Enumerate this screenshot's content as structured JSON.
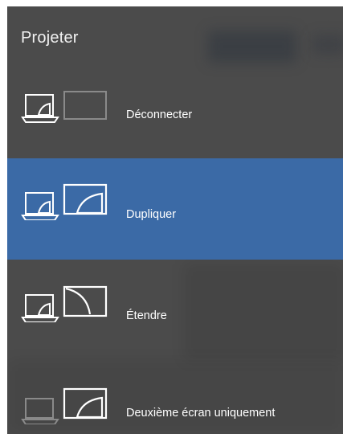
{
  "panel": {
    "title": "Projeter"
  },
  "options": [
    {
      "id": "disconnect",
      "label": "Déconnecter",
      "icon": "pc-screen-only-icon",
      "selected": false
    },
    {
      "id": "duplicate",
      "label": "Dupliquer",
      "icon": "duplicate-icon",
      "selected": true
    },
    {
      "id": "extend",
      "label": "Étendre",
      "icon": "extend-icon",
      "selected": false
    },
    {
      "id": "second",
      "label": "Deuxième écran uniquement",
      "icon": "second-screen-only-icon",
      "selected": false
    }
  ],
  "colors": {
    "panel_background": "#4b4b4b",
    "selected_background": "#3b6aa6",
    "text": "#ffffff",
    "dim_icon": "#8a8a8a"
  }
}
